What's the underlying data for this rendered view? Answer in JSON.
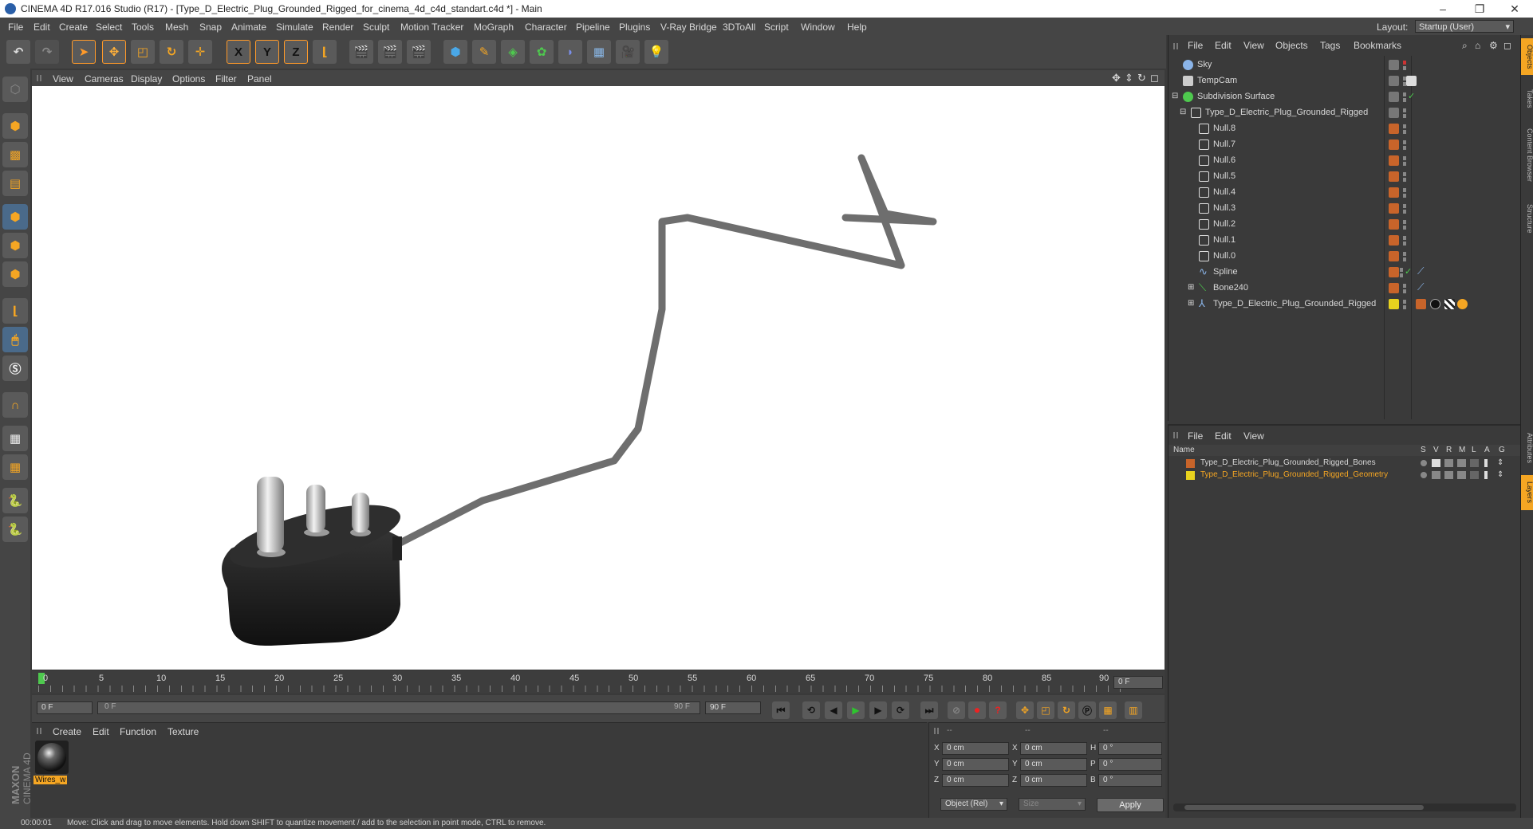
{
  "window": {
    "title": "CINEMA 4D R17.016 Studio (R17) - [Type_D_Electric_Plug_Grounded_Rigged_for_cinema_4d_c4d_standart.c4d *] - Main",
    "minimize": "–",
    "restore": "❐",
    "close": "✕"
  },
  "menu": [
    "File",
    "Edit",
    "Create",
    "Select",
    "Tools",
    "Mesh",
    "Snap",
    "Animate",
    "Simulate",
    "Render",
    "Sculpt",
    "Motion Tracker",
    "MoGraph",
    "Character",
    "Pipeline",
    "Plugins",
    "V-Ray Bridge",
    "3DToAll",
    "Script",
    "Window",
    "Help"
  ],
  "layout": {
    "label": "Layout:",
    "value": "Startup (User)"
  },
  "toolbar": {
    "x_label": "X",
    "y_label": "Y",
    "z_label": "Z"
  },
  "viewport": {
    "menu": [
      "View",
      "Cameras",
      "Display",
      "Options",
      "Filter",
      "Panel"
    ]
  },
  "timeline": {
    "ticks": [
      "0",
      "5",
      "10",
      "15",
      "20",
      "25",
      "30",
      "35",
      "40",
      "45",
      "50",
      "55",
      "60",
      "65",
      "70",
      "75",
      "80",
      "85",
      "90"
    ],
    "frame_field": "0 F"
  },
  "playback": {
    "start": "0 F",
    "range_start": "0 F",
    "range_end": "90 F",
    "end": "90 F"
  },
  "material_panel": {
    "menu": [
      "Create",
      "Edit",
      "Function",
      "Texture"
    ],
    "material_name": "Wires_w"
  },
  "coordinates": {
    "headers": [
      "--",
      "--",
      "--"
    ],
    "rows": [
      {
        "a": "X",
        "av": "0 cm",
        "b": "X",
        "bv": "0 cm",
        "c": "H",
        "cv": "0 °"
      },
      {
        "a": "Y",
        "av": "0 cm",
        "b": "Y",
        "bv": "0 cm",
        "c": "P",
        "cv": "0 °"
      },
      {
        "a": "Z",
        "av": "0 cm",
        "b": "Z",
        "bv": "0 cm",
        "c": "B",
        "cv": "0 °"
      }
    ],
    "mode": "Object (Rel)",
    "size": "Size",
    "apply": "Apply"
  },
  "objects_panel": {
    "menu": [
      "File",
      "Edit",
      "View",
      "Objects",
      "Tags",
      "Bookmarks"
    ],
    "items": [
      {
        "name": "Sky",
        "indent": 0
      },
      {
        "name": "TempCam",
        "indent": 0
      },
      {
        "name": "Subdivision Surface",
        "indent": 0
      },
      {
        "name": "Type_D_Electric_Plug_Grounded_Rigged",
        "indent": 1
      },
      {
        "name": "Null.8",
        "indent": 2
      },
      {
        "name": "Null.7",
        "indent": 2
      },
      {
        "name": "Null.6",
        "indent": 2
      },
      {
        "name": "Null.5",
        "indent": 2
      },
      {
        "name": "Null.4",
        "indent": 2
      },
      {
        "name": "Null.3",
        "indent": 2
      },
      {
        "name": "Null.2",
        "indent": 2
      },
      {
        "name": "Null.1",
        "indent": 2
      },
      {
        "name": "Null.0",
        "indent": 2
      },
      {
        "name": "Spline",
        "indent": 2
      },
      {
        "name": "Bone240",
        "indent": 2
      },
      {
        "name": "Type_D_Electric_Plug_Grounded_Rigged",
        "indent": 2
      }
    ]
  },
  "layers_panel": {
    "menu": [
      "File",
      "Edit",
      "View"
    ],
    "columns": [
      "Name",
      "S",
      "V",
      "R",
      "M",
      "L",
      "A",
      "G"
    ],
    "layers": [
      {
        "name": "Type_D_Electric_Plug_Grounded_Rigged_Bones",
        "color": "#c8642a"
      },
      {
        "name": "Type_D_Electric_Plug_Grounded_Rigged_Geometry",
        "color": "#e8d21e"
      }
    ]
  },
  "right_tabs": [
    "Objects",
    "Takes",
    "Content Browser",
    "Structure",
    "Attributes",
    "Layers"
  ],
  "status": {
    "time": "00:00:01",
    "message": "Move: Click and drag to move elements. Hold down SHIFT to quantize movement / add to the selection in point mode, CTRL to remove."
  },
  "brand": {
    "maxon": "MAXON",
    "c4d": "CINEMA 4D"
  }
}
